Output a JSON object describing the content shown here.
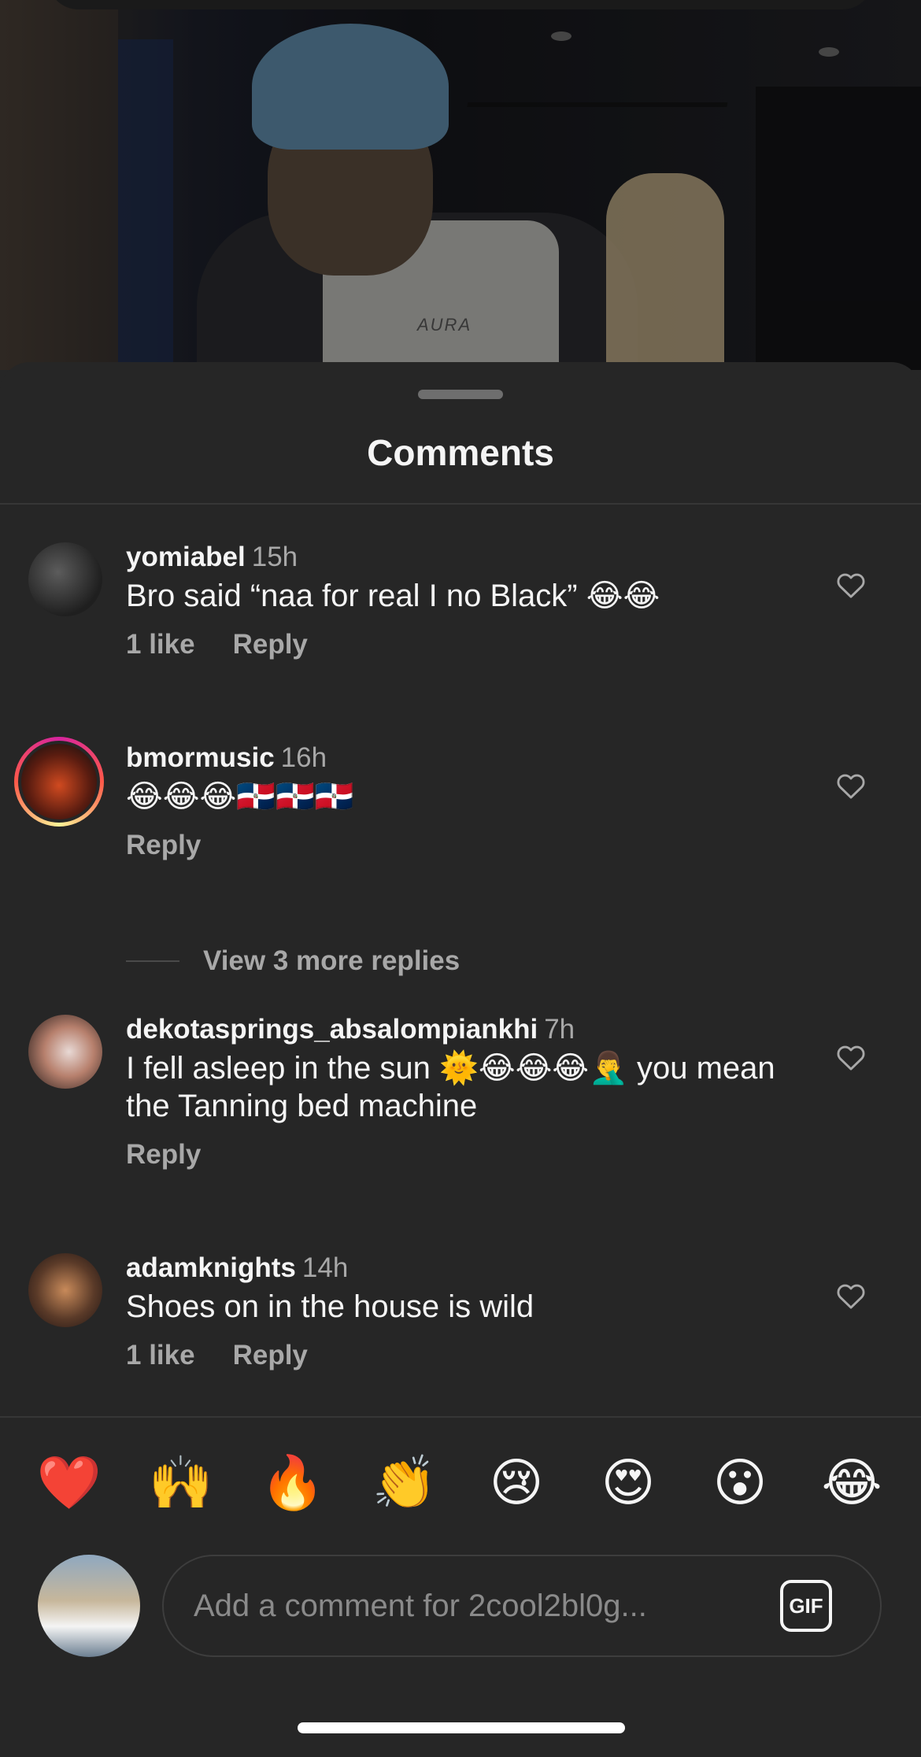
{
  "sheet": {
    "title": "Comments"
  },
  "video": {
    "jersey_text": "AURA"
  },
  "comments": [
    {
      "user": "yomiabel",
      "time": "15h",
      "text": "Bro said “naa for real I no Black” 😂😂",
      "likes": "1 like",
      "reply": "Reply"
    },
    {
      "user": "bmormusic",
      "time": "16h",
      "text": "😂😂😂🇩🇴🇩🇴🇩🇴",
      "likes": "",
      "reply": "Reply"
    },
    {
      "user": "dekotasprings_absalompiankhi",
      "time": "7h",
      "text": "I fell asleep in the sun 🌞😂😂😂🤦‍♂️ you mean the Tanning bed machine",
      "likes": "",
      "reply": "Reply"
    },
    {
      "user": "adamknights",
      "time": "14h",
      "text": "Shoes on in the house is wild",
      "likes": "1 like",
      "reply": "Reply"
    }
  ],
  "view_more_replies": "View 3 more replies",
  "quick_emojis": [
    "❤️",
    "🙌",
    "🔥",
    "👏",
    "😢",
    "😍",
    "😮",
    "😂"
  ],
  "composer": {
    "placeholder": "Add a comment for 2cool2bl0g...",
    "gif_label": "GIF"
  },
  "icons": {
    "like": "heart-outline-icon",
    "gif": "gif-icon"
  },
  "colors": {
    "background": "#262626",
    "text_primary": "#f5f5f5",
    "text_secondary": "#a8a8a8"
  }
}
